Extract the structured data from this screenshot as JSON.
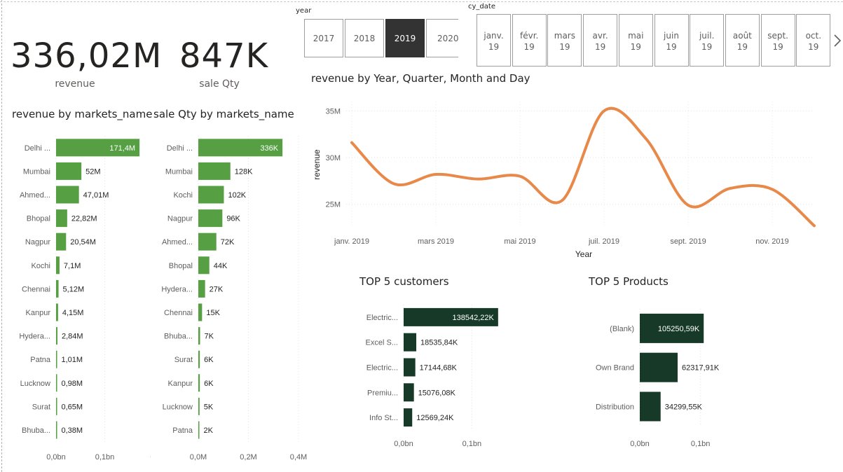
{
  "kpis": {
    "revenue_value": "336,02M",
    "revenue_label": "revenue",
    "qty_value": "847K",
    "qty_label": "sale Qty"
  },
  "slicers": {
    "year": {
      "header": "year",
      "options": [
        "2017",
        "2018",
        "2019",
        "2020"
      ],
      "selected": "2019"
    },
    "cy_date": {
      "header": "cy_date",
      "options": [
        {
          "m": "janv.",
          "y": "19"
        },
        {
          "m": "févr.",
          "y": "19"
        },
        {
          "m": "mars",
          "y": "19"
        },
        {
          "m": "avr.",
          "y": "19"
        },
        {
          "m": "mai",
          "y": "19"
        },
        {
          "m": "juin",
          "y": "19"
        },
        {
          "m": "juil.",
          "y": "19"
        },
        {
          "m": "août",
          "y": "19"
        },
        {
          "m": "sept.",
          "y": "19"
        },
        {
          "m": "oct.",
          "y": "19"
        }
      ],
      "next_icon": "chevron-right-icon"
    }
  },
  "chart_data": [
    {
      "id": "revenue-by-market",
      "type": "bar",
      "orientation": "horizontal",
      "title": "revenue by markets_name",
      "categories": [
        "Delhi ...",
        "Mumbai",
        "Ahmed...",
        "Bhopal",
        "Nagpur",
        "Kochi",
        "Chennai",
        "Kanpur",
        "Hydera...",
        "Patna",
        "Lucknow",
        "Surat",
        "Bhuba..."
      ],
      "values": [
        171.4,
        52,
        47.01,
        22.82,
        20.54,
        7.1,
        5.12,
        4.15,
        2.84,
        1.01,
        0.98,
        0.65,
        0.38
      ],
      "value_unit": "M",
      "data_labels": [
        "171,4M",
        "52M",
        "47,01M",
        "22,82M",
        "20,54M",
        "7,1M",
        "5,12M",
        "4,15M",
        "2,84M",
        "1,01M",
        "0,98M",
        "0,65M",
        "0,38M"
      ],
      "x_ticks": [
        "0,0bn",
        "0,1bn",
        "0,"
      ],
      "x_tick_values": [
        0,
        100,
        200
      ],
      "xlim": [
        0,
        200
      ],
      "color": "#56A043",
      "grid": true
    },
    {
      "id": "qty-by-market",
      "type": "bar",
      "orientation": "horizontal",
      "title": "sale Qty by markets_name",
      "categories": [
        "Delhi ...",
        "Mumbai",
        "Kochi",
        "Nagpur",
        "Ahmed...",
        "Bhopal",
        "Hydera...",
        "Chennai",
        "Bhuba...",
        "Surat",
        "Kanpur",
        "Lucknow",
        "Patna"
      ],
      "values": [
        336,
        128,
        102,
        96,
        72,
        44,
        27,
        15,
        7,
        6,
        6,
        5,
        2
      ],
      "value_unit": "K",
      "data_labels": [
        "336K",
        "128K",
        "102K",
        "96K",
        "72K",
        "44K",
        "27K",
        "15K",
        "7K",
        "6K",
        "6K",
        "5K",
        "2K"
      ],
      "x_ticks": [
        "0,0M",
        "0,2M",
        "0,4M"
      ],
      "x_tick_values": [
        0,
        200,
        400
      ],
      "xlim": [
        0,
        400
      ],
      "color": "#56A043",
      "grid": true
    },
    {
      "id": "revenue-trend",
      "type": "line",
      "title": "revenue by Year, Quarter, Month and Day",
      "xlabel": "Year",
      "ylabel": "revenue",
      "x": [
        "2019-01-01",
        "2019-02-01",
        "2019-03-01",
        "2019-04-01",
        "2019-05-01",
        "2019-06-01",
        "2019-07-01",
        "2019-08-01",
        "2019-09-01",
        "2019-10-01",
        "2019-11-01",
        "2019-12-01"
      ],
      "values": [
        31.6,
        27.2,
        28.2,
        27.7,
        28.0,
        25.4,
        35.0,
        32.0,
        24.9,
        26.7,
        26.6,
        22.7
      ],
      "ylim": [
        22.5,
        36
      ],
      "y_ticks": [
        "25M",
        "30M",
        "35M"
      ],
      "y_tick_values": [
        25,
        30,
        35
      ],
      "x_ticks": [
        "janv. 2019",
        "mars 2019",
        "mai 2019",
        "juil. 2019",
        "sept. 2019",
        "nov. 2019"
      ],
      "color": "#E8894A",
      "grid": true
    },
    {
      "id": "top-customers",
      "type": "bar",
      "orientation": "horizontal",
      "title": "TOP 5 customers",
      "categories": [
        "Electric...",
        "Excel S...",
        "Electric...",
        "Premiu...",
        "Info St..."
      ],
      "values": [
        138542.22,
        18535.84,
        17144.68,
        15076.08,
        12569.24
      ],
      "value_unit": "K",
      "data_labels": [
        "138542,22K",
        "18535,84K",
        "17144,68K",
        "15076,08K",
        "12569,24K"
      ],
      "x_ticks": [
        "0,0bn",
        "0,1bn"
      ],
      "x_tick_values": [
        0,
        100000
      ],
      "xlim": [
        0,
        150000
      ],
      "color": "#173A28",
      "grid": true
    },
    {
      "id": "top-products",
      "type": "bar",
      "orientation": "horizontal",
      "title": "TOP 5 Products",
      "categories": [
        "(Blank)",
        "Own Brand",
        "Distribution"
      ],
      "values": [
        105250.59,
        62317.91,
        34299.55
      ],
      "value_unit": "K",
      "data_labels": [
        "105250,59K",
        "62317,91K",
        "34299,55K"
      ],
      "x_ticks": [
        "0,0bn",
        "0,1bn"
      ],
      "x_tick_values": [
        0,
        100000
      ],
      "xlim": [
        0,
        120000
      ],
      "color": "#173A28",
      "grid": true
    }
  ]
}
